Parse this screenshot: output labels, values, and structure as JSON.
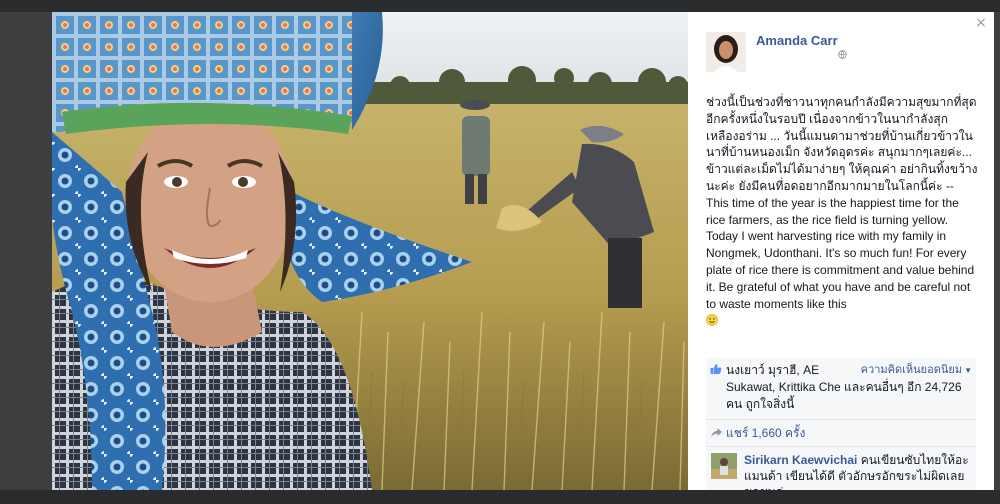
{
  "post": {
    "author": "Amanda Carr",
    "privacy_icon": "globe-icon",
    "text_thai": "ช่วงนี้เป็นช่วงที่ชาวนาทุกคนกำลังมีความสุขมากที่สุดอีกครั้งหนึ่งในรอบปี เนื่องจากข้าวในนากำลังสุกเหลืองอร่าม ... วันนี้แมนดามาช่วยที่บ้านเกี่ยวข้าวในนาที่บ้านหนองเม็ก จังหวัดอุดรค่ะ สนุกมากๆเลยค่ะ... ข้าวแต่ละเม็ดไม่ได้มาง่ายๆ ให้คุณค่า อย่ากินทิ้งขว้างนะค่ะ ยังมีคนที่อดอยากอีกมากมายในโลกนี้ค่ะ --",
    "text_english": "This time of the year is the happiest time for the rice farmers, as the rice field is turning yellow. Today I went harvesting rice with my family in Nongmek, Udonthani. It's so much fun! For every plate of rice there is commitment and value behind it. Be grateful of what you have and be careful not to waste moments like this",
    "emoji_icon": "smile-icon"
  },
  "engagement": {
    "likes_line1": "นงเยาว์ มุราฮี, AE",
    "likes_line2": "Sukawat, Krittika Che และคนอื่นๆ อีก 24,726 คน ถูกใจสิ่งนี้",
    "top_comments_label": "ความคิดเห็นยอดนิยม",
    "shares_text": "แชร์ 1,660 ครั้ง"
  },
  "comment": {
    "author": "Sirikarn Kaewvichai",
    "text": "คนเขียนซับไทยให้อะแมนด้า เขียนได้ดี ตัวอักษรอักขระไม่ผิดเลย ขอชมค่ะ"
  },
  "controls": {
    "close_glyph": "×"
  },
  "colors": {
    "link_blue": "#3b5998",
    "text": "#141823",
    "panel_bg": "#ffffff",
    "engagement_bg": "#f6f7f8",
    "backdrop": "#3a3b3d"
  }
}
